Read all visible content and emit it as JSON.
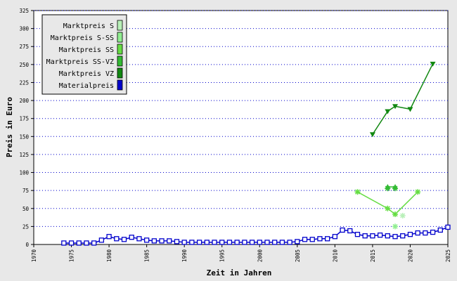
{
  "chart_data": {
    "type": "line",
    "xlabel": "Zeit in Jahren",
    "ylabel": "Preis in Euro",
    "xlim": [
      1970,
      2025
    ],
    "ylim": [
      0,
      325
    ],
    "x_ticks": [
      1970,
      1975,
      1980,
      1985,
      1990,
      1995,
      2000,
      2005,
      2010,
      2015,
      2020,
      2025
    ],
    "y_ticks": [
      0,
      25,
      50,
      75,
      100,
      125,
      150,
      175,
      200,
      225,
      250,
      275,
      300,
      325
    ],
    "grid": "horizontal dotted",
    "legend_position": "top-left",
    "series": [
      {
        "name": "Marktpreis S",
        "color": "#b8f0b8",
        "marker": "none",
        "points": []
      },
      {
        "name": "Marktpreis S-SS",
        "color": "#90ee90",
        "marker": "star",
        "points": [
          [
            2018,
            25
          ]
        ]
      },
      {
        "name": "Marktpreis SS",
        "color": "#66dd44",
        "marker": "star",
        "points": [
          [
            2013,
            73
          ],
          [
            2017,
            50
          ],
          [
            2018,
            42
          ],
          [
            2021,
            73
          ]
        ]
      },
      {
        "name": "Marktpreis SS-VZ",
        "color": "#33bb33",
        "marker": "triangle-up",
        "points": [
          [
            2017,
            80
          ],
          [
            2018,
            80
          ]
        ]
      },
      {
        "name": "Marktpreis VZ",
        "color": "#118811",
        "marker": "triangle-down",
        "points": [
          [
            2015,
            153
          ],
          [
            2017,
            185
          ],
          [
            2018,
            192
          ],
          [
            2020,
            188
          ],
          [
            2023,
            251
          ]
        ]
      },
      {
        "name": "Materialpreis",
        "color": "#0000cc",
        "marker": "square",
        "points": [
          [
            1974,
            2
          ],
          [
            1975,
            2
          ],
          [
            1976,
            2
          ],
          [
            1977,
            2
          ],
          [
            1978,
            2
          ],
          [
            1979,
            6
          ],
          [
            1980,
            11
          ],
          [
            1981,
            8
          ],
          [
            1982,
            7
          ],
          [
            1983,
            10
          ],
          [
            1984,
            8
          ],
          [
            1985,
            6
          ],
          [
            1986,
            5
          ],
          [
            1987,
            5
          ],
          [
            1988,
            5
          ],
          [
            1989,
            4
          ],
          [
            1990,
            3
          ],
          [
            1991,
            3
          ],
          [
            1992,
            3
          ],
          [
            1993,
            3
          ],
          [
            1994,
            3
          ],
          [
            1995,
            3
          ],
          [
            1996,
            3
          ],
          [
            1997,
            3
          ],
          [
            1998,
            3
          ],
          [
            1999,
            3
          ],
          [
            2000,
            3
          ],
          [
            2001,
            3
          ],
          [
            2002,
            3
          ],
          [
            2003,
            3
          ],
          [
            2004,
            3
          ],
          [
            2005,
            4
          ],
          [
            2006,
            7
          ],
          [
            2007,
            7
          ],
          [
            2008,
            8
          ],
          [
            2009,
            8
          ],
          [
            2010,
            11
          ],
          [
            2011,
            20
          ],
          [
            2012,
            19
          ],
          [
            2013,
            14
          ],
          [
            2014,
            12
          ],
          [
            2015,
            12
          ],
          [
            2016,
            13
          ],
          [
            2017,
            12
          ],
          [
            2018,
            11
          ],
          [
            2019,
            12
          ],
          [
            2020,
            14
          ],
          [
            2021,
            16
          ],
          [
            2022,
            16
          ],
          [
            2023,
            17
          ],
          [
            2024,
            20
          ],
          [
            2025,
            24
          ]
        ]
      }
    ],
    "extra_markers": [
      {
        "series": "Marktpreis SS-VZ",
        "x": 2017,
        "y": 78,
        "marker": "star"
      },
      {
        "series": "Marktpreis SS-VZ",
        "x": 2018,
        "y": 78,
        "marker": "star"
      },
      {
        "series": "Marktpreis S",
        "x": 2019,
        "y": 40,
        "marker": "star"
      }
    ]
  }
}
